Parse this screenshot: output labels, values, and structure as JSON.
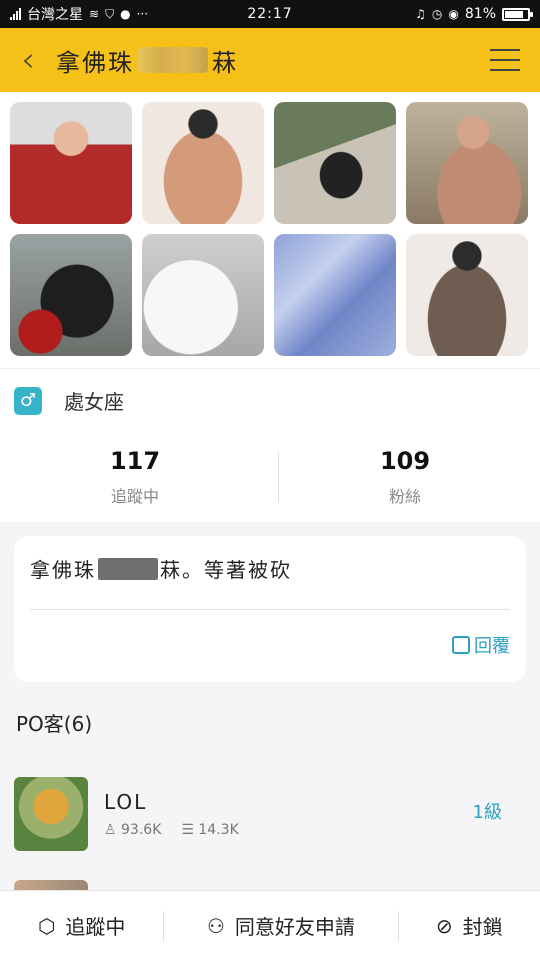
{
  "status_bar": {
    "carrier": "台灣之星",
    "time": "22:17",
    "battery": "81%",
    "battery_level": 0.81
  },
  "header": {
    "title_prefix": "拿佛珠",
    "title_suffix": "菻",
    "back_icon": "chevron-left-icon",
    "menu_icon": "hamburger-menu-icon"
  },
  "photos": [
    {
      "name": "photo-1"
    },
    {
      "name": "photo-2"
    },
    {
      "name": "photo-3"
    },
    {
      "name": "photo-4"
    },
    {
      "name": "photo-5"
    },
    {
      "name": "photo-6"
    },
    {
      "name": "photo-7"
    },
    {
      "name": "photo-8"
    }
  ],
  "profile": {
    "gender_icon": "male-icon",
    "zodiac": "處女座"
  },
  "stats": {
    "following_count": "117",
    "following_label": "追蹤中",
    "followers_count": "109",
    "followers_label": "粉絲"
  },
  "status_post": {
    "text_start": "拿佛珠",
    "text_end": "菻。等著被砍",
    "reply_label": "回覆"
  },
  "posts_section": {
    "heading": "PO客(6)"
  },
  "game": {
    "name": "LOL",
    "views": "93.6K",
    "posts": "14.3K",
    "level": "1級"
  },
  "bottom_bar": {
    "follow_label": "追蹤中",
    "accept_label": "同意好友申請",
    "block_label": "封鎖"
  },
  "colors": {
    "header_bg": "#f5c118",
    "accent_teal": "#2f9fbf",
    "male_badge": "#36b4c9"
  }
}
